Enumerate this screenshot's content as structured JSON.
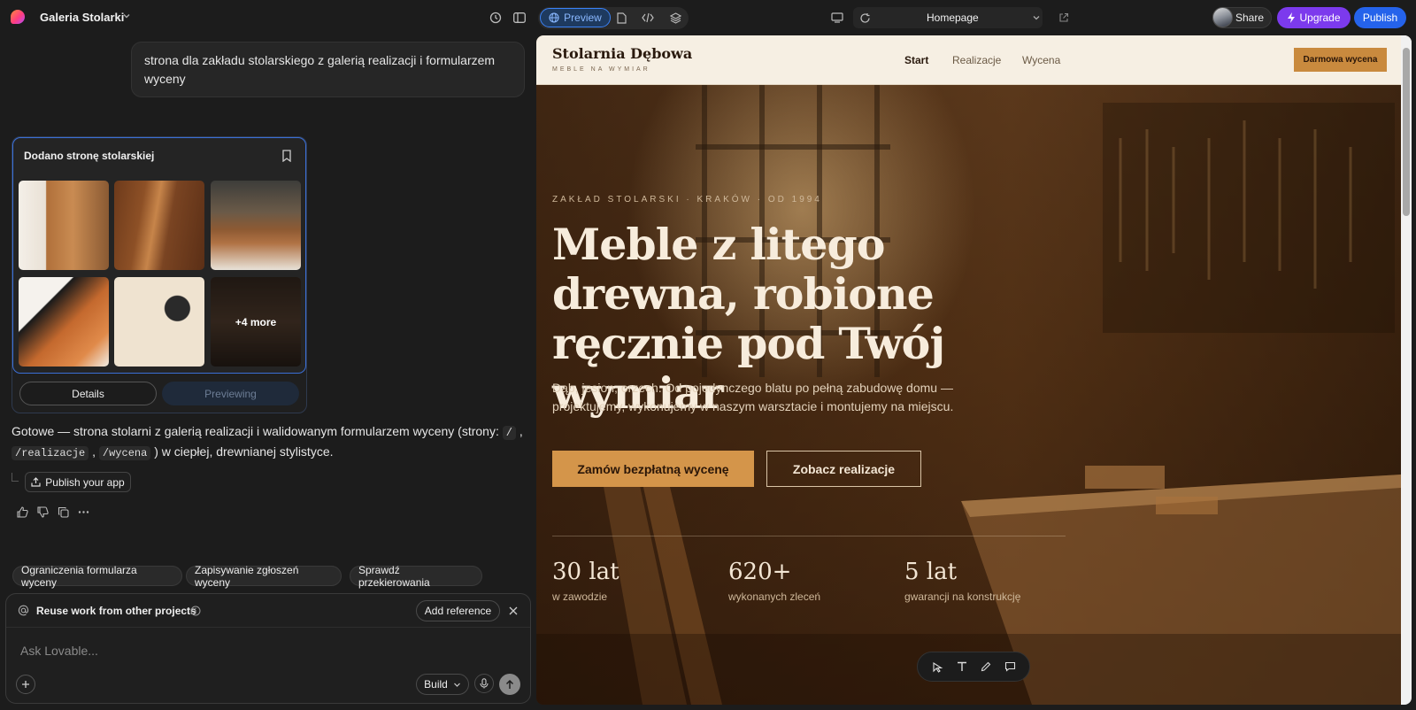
{
  "app": {
    "project_name": "Galeria Stolarki",
    "preview_label": "Preview",
    "route": "Homepage",
    "share_label": "Share",
    "upgrade_label": "Upgrade",
    "publish_label": "Publish"
  },
  "chat": {
    "user_message": "strona dla zakładu stolarskiego z galerią realizacji i formularzem wyceny",
    "card": {
      "title": "Dodano stronę stolarskiej",
      "more_label": "+4 more",
      "details_label": "Details",
      "previewing_label": "Previewing"
    },
    "assistant": {
      "text_before": "Gotowe — strona stolarni z galerią realizacji i walidowanym formularzem wyceny (strony: ",
      "code1": "/",
      "sep1": " , ",
      "code2": "/realizacje",
      "sep2": " , ",
      "code3": "/wycena",
      "text_after": " ) w ciepłej, drewnianej stylistyce."
    },
    "publish_app_label": "Publish your app",
    "suggestions": [
      "Ograniczenia formularza wyceny",
      "Zapisywanie zgłoszeń wyceny",
      "Sprawdź przekierowania"
    ],
    "composer": {
      "reuse_label": "Reuse work from other projects",
      "add_reference_label": "Add reference",
      "placeholder": "Ask Lovable...",
      "mode_label": "Build"
    }
  },
  "site": {
    "brand": "Stolarnia Dębowa",
    "brand_sub": "MEBLE NA WYMIAR",
    "nav": [
      "Start",
      "Realizacje",
      "Wycena"
    ],
    "nav_cta": "Darmowa wycena",
    "eyebrow": "ZAKŁAD STOLARSKI · KRAKÓW · OD 1994",
    "headline": "Meble z litego drewna, robione ręcznie pod Twój wymiar",
    "lead": "Dąb, jesion, orzech. Od pojedynczego blatu po pełną zabudowę domu — projektujemy, wykonujemy w naszym warsztacie i montujemy na miejscu.",
    "cta_primary": "Zamów bezpłatną wycenę",
    "cta_secondary": "Zobacz realizacje",
    "stats": [
      {
        "value": "30 lat",
        "label": "w zawodzie"
      },
      {
        "value": "620+",
        "label": "wykonanych zleceń"
      },
      {
        "value": "5 lat",
        "label": "gwarancji na konstrukcję"
      }
    ]
  }
}
